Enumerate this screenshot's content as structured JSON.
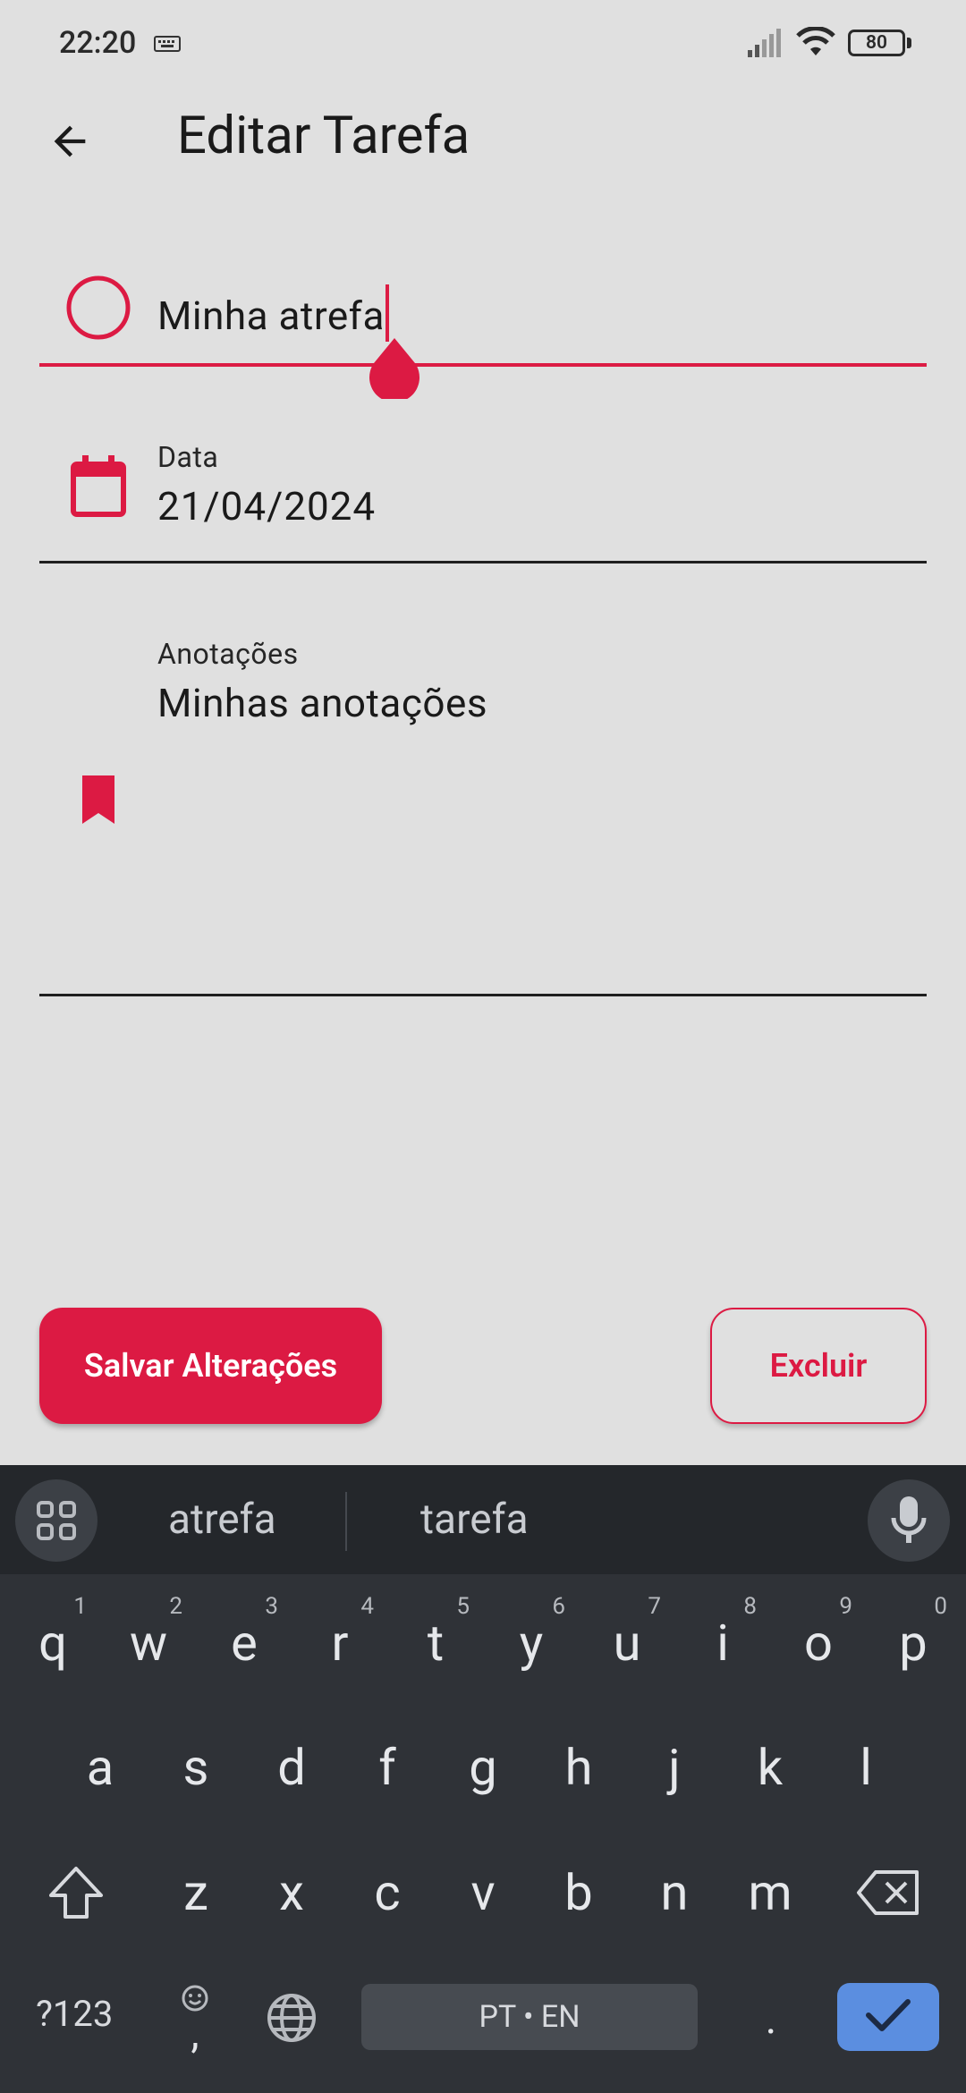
{
  "status_bar": {
    "time": "22:20",
    "battery": "80"
  },
  "app_bar": {
    "title": "Editar Tarefa"
  },
  "form": {
    "task_name_value": "Minha atrefa",
    "date_label": "Data",
    "date_value": "21/04/2024",
    "notes_label": "Anotações",
    "notes_value": "Minhas anotações"
  },
  "actions": {
    "save_label": "Salvar Alterações",
    "delete_label": "Excluir"
  },
  "keyboard": {
    "suggestions": [
      "atrefa",
      "tarefa"
    ],
    "row1": [
      {
        "k": "q",
        "h": "1"
      },
      {
        "k": "w",
        "h": "2"
      },
      {
        "k": "e",
        "h": "3"
      },
      {
        "k": "r",
        "h": "4"
      },
      {
        "k": "t",
        "h": "5"
      },
      {
        "k": "y",
        "h": "6"
      },
      {
        "k": "u",
        "h": "7"
      },
      {
        "k": "i",
        "h": "8"
      },
      {
        "k": "o",
        "h": "9"
      },
      {
        "k": "p",
        "h": "0"
      }
    ],
    "row2": [
      "a",
      "s",
      "d",
      "f",
      "g",
      "h",
      "j",
      "k",
      "l"
    ],
    "row3": [
      "z",
      "x",
      "c",
      "v",
      "b",
      "n",
      "m"
    ],
    "symbols_label": "?123",
    "comma_label": ",",
    "space_label": "PT • EN",
    "period_label": "."
  },
  "colors": {
    "accent": "#dc1a43",
    "background": "#e0e0e0",
    "keyboard_bg": "#2f3237",
    "enter_key": "#5b8ee0"
  },
  "icons": [
    "back-arrow-icon",
    "radio-circle-icon",
    "calendar-icon",
    "bookmark-icon",
    "apps-grid-icon",
    "mic-icon",
    "shift-icon",
    "backspace-icon",
    "emoji-icon",
    "globe-icon",
    "checkmark-icon",
    "signal-icon",
    "wifi-icon",
    "keyboard-indicator-icon"
  ]
}
